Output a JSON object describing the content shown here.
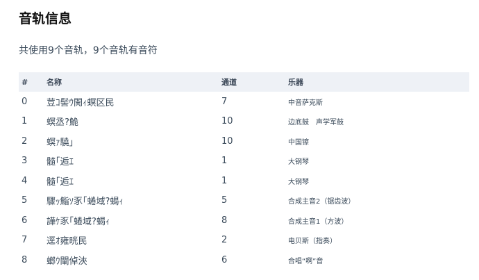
{
  "page": {
    "title": "音轨信息",
    "summary": "共使用9个音轨，9个音轨有音符"
  },
  "table": {
    "headers": {
      "index": "#",
      "name": "名称",
      "channel": "通道",
      "instrument": "乐器"
    },
    "rows": [
      {
        "index": "0",
        "name": "荳ｺ髻ｳ閧ｨ螟区民",
        "channel": "7",
        "instrument": "中音萨克斯"
      },
      {
        "index": "1",
        "name": "螟丞?鮠",
        "channel": "10",
        "instrument": "边底鼓　声学军鼓"
      },
      {
        "index": "2",
        "name": "螟ｧ驍｣",
        "channel": "10",
        "instrument": "中国镲"
      },
      {
        "index": "3",
        "name": "髓｢逅ｴ",
        "channel": "1",
        "instrument": "大钢琴"
      },
      {
        "index": "4",
        "name": "髓｢逅ｴ",
        "channel": "1",
        "instrument": "大钢琴"
      },
      {
        "index": "5",
        "name": "驟ｯ鮨ｿ豕｢蜷域?蝎ｨ",
        "channel": "5",
        "instrument": "合成主音2（锯齿波）"
      },
      {
        "index": "6",
        "name": "譁ｹ豕｢蜷域?蝎ｨ",
        "channel": "8",
        "instrument": "合成主音1（方波）"
      },
      {
        "index": "7",
        "name": "逕ｵ雍晄民",
        "channel": "2",
        "instrument": "电贝斯（指奏）"
      },
      {
        "index": "8",
        "name": "螂ｳ闡倬浹",
        "channel": "6",
        "instrument": "合唱“啊”音"
      }
    ]
  }
}
